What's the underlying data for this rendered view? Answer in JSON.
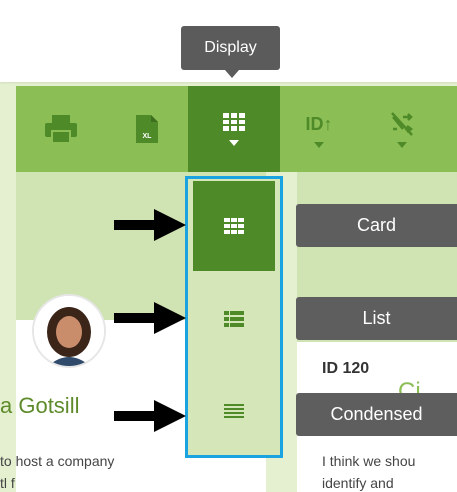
{
  "tooltip": {
    "text": "Display"
  },
  "toolbar": {
    "buttons": [
      {
        "icon": "printer-icon"
      },
      {
        "icon": "excel-export-icon",
        "badge": "XL"
      },
      {
        "icon": "grid-display-icon",
        "active": true
      },
      {
        "icon": "sort-id-icon",
        "label": "ID↑"
      },
      {
        "icon": "shuffle-off-icon"
      }
    ]
  },
  "display_menu": {
    "options": [
      {
        "label": "Card",
        "icon": "card-view-icon",
        "selected": true
      },
      {
        "label": "List",
        "icon": "list-view-icon",
        "selected": false
      },
      {
        "label": "Condensed",
        "icon": "condensed-view-icon",
        "selected": false
      }
    ]
  },
  "left_card": {
    "name": "a Gotsill",
    "text_line1": "to host a company",
    "text_line2": "tl f"
  },
  "right_card": {
    "id_label": "ID 120",
    "partial_title": "Ci",
    "text_line1": "I think we shou",
    "text_line2": "identify and"
  },
  "colors": {
    "toolbar_green": "#8cbe56",
    "active_green": "#4e8a28",
    "light_green": "#cfe4b2",
    "highlight_blue": "#1aa3e0",
    "label_gray": "#5e5e5e"
  }
}
